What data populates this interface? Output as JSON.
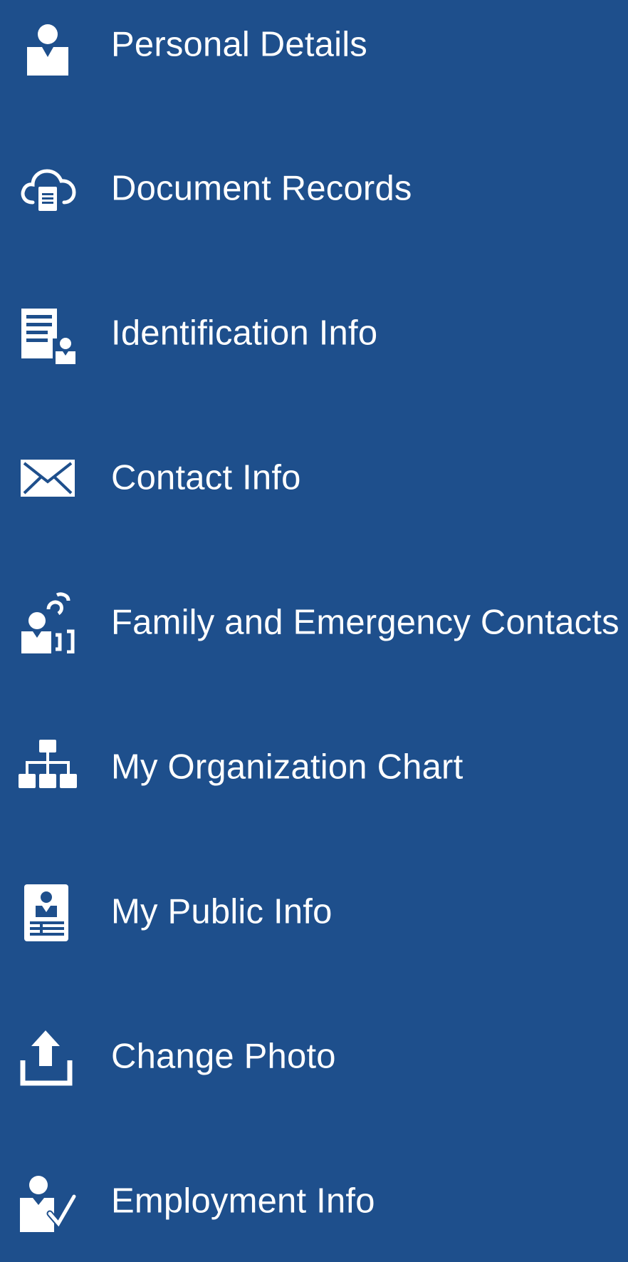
{
  "theme": {
    "background": "#1e4f8c",
    "foreground": "#ffffff"
  },
  "menu": {
    "items": [
      {
        "label": "Personal Details",
        "icon": "person-icon"
      },
      {
        "label": "Document Records",
        "icon": "cloud-document-icon"
      },
      {
        "label": "Identification Info",
        "icon": "id-document-icon"
      },
      {
        "label": "Contact Info",
        "icon": "envelope-icon"
      },
      {
        "label": "Family and Emergency Contacts",
        "icon": "family-contacts-icon"
      },
      {
        "label": "My Organization Chart",
        "icon": "org-chart-icon"
      },
      {
        "label": "My Public Info",
        "icon": "id-badge-icon"
      },
      {
        "label": "Change Photo",
        "icon": "upload-icon"
      },
      {
        "label": "Employment Info",
        "icon": "person-check-icon"
      }
    ]
  }
}
